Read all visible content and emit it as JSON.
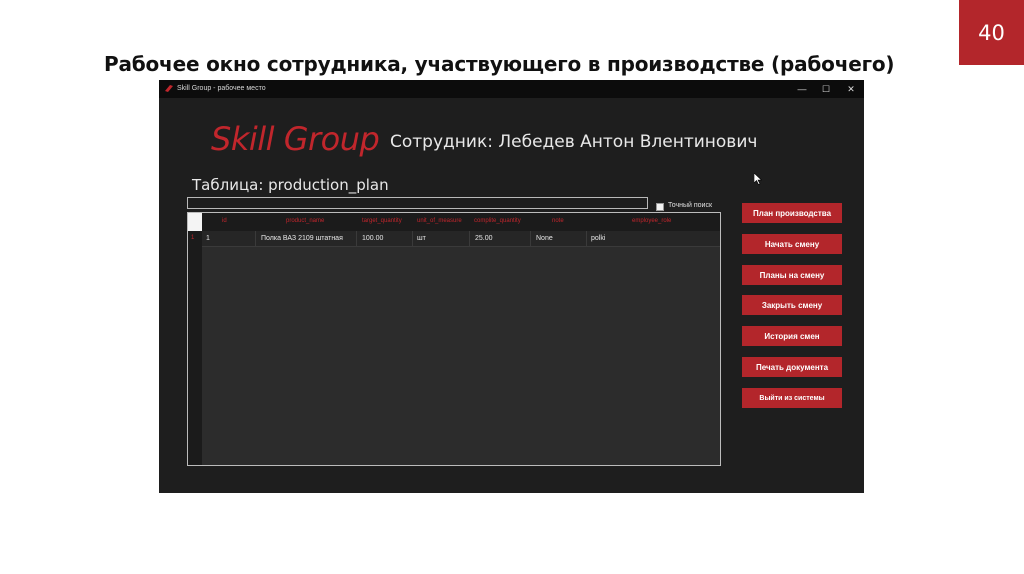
{
  "slide": {
    "number": "40",
    "title": "Рабочее окно сотрудника, участвующего в производстве (рабочего)"
  },
  "window": {
    "title": "Skill Group - рабочее место",
    "controls": {
      "minimize": "—",
      "maximize": "☐",
      "close": "✕"
    }
  },
  "app": {
    "brand": "Skill Group",
    "employee": "Сотрудник: Лебедев Антон Влентинович",
    "table_title": "Таблица: production_plan",
    "search": {
      "value": "",
      "placeholder": ""
    },
    "exact_search_label": "Точный поиск"
  },
  "table": {
    "columns": [
      "id",
      "product_name",
      "target_quantity",
      "unit_of_measure",
      "complite_quantity",
      "note",
      "employee_role"
    ],
    "rows": [
      {
        "row_number": "1",
        "cells": [
          "1",
          "Полка ВАЗ 2109 штатная",
          "100.00",
          "шт",
          "25.00",
          "None",
          "polki"
        ]
      }
    ]
  },
  "buttons": {
    "production_plan": "План производства",
    "start_shift": "Начать смену",
    "shift_plans": "Планы на смену",
    "close_shift": "Закрыть смену",
    "shift_history": "История смен",
    "print_document": "Печать документа",
    "logout": "Выйти из системы"
  },
  "colors": {
    "accent": "#b3262b",
    "window_bg": "#1e1e1e",
    "titlebar_bg": "#0c0c0c"
  }
}
